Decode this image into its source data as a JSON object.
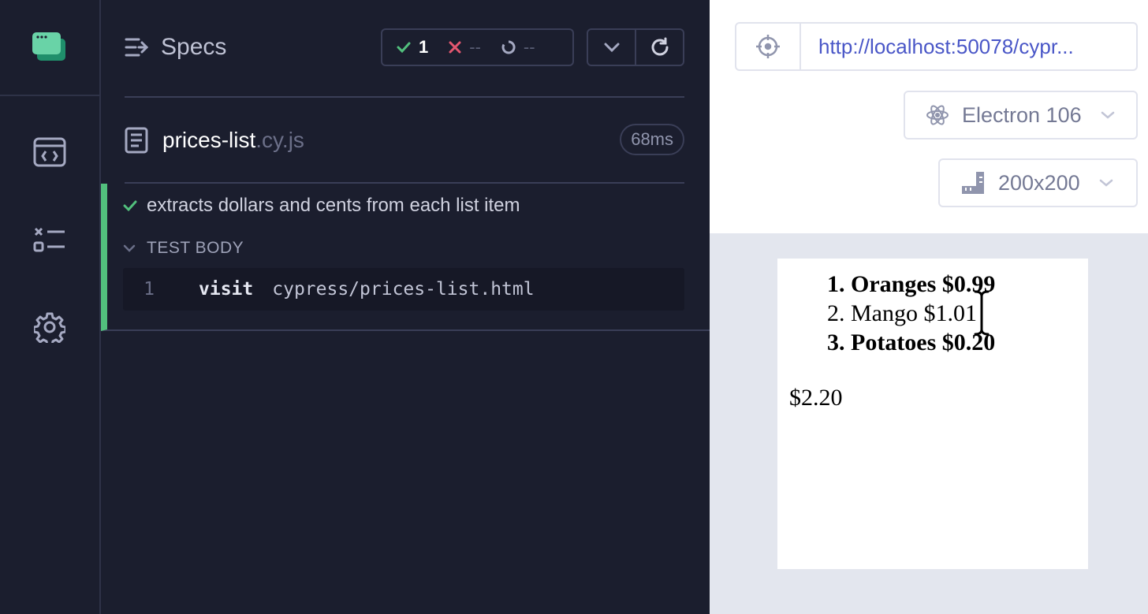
{
  "specs_panel": {
    "title": "Specs",
    "stats": {
      "passed": "1",
      "failed": "--",
      "pending": "--"
    }
  },
  "spec": {
    "name": "prices-list",
    "ext": ".cy.js",
    "duration": "68ms"
  },
  "test": {
    "title": "extracts dollars and cents from each list item",
    "body_label": "TEST BODY",
    "commands": [
      {
        "num": "1",
        "name": "visit",
        "arg": "cypress/prices-list.html"
      }
    ]
  },
  "aut": {
    "url": "http://localhost:50078/cypr...",
    "browser": "Electron 106",
    "viewport": "200x200",
    "list": [
      {
        "label": "1. Oranges $0.99",
        "bold": true
      },
      {
        "label": "2. Mango $1.01",
        "bold": false
      },
      {
        "label": "3. Potatoes $0.20",
        "bold": true
      }
    ],
    "total": "$2.20"
  },
  "colors": {
    "pass": "#52c07d",
    "fail": "#e45770",
    "accent_link": "#4956c7",
    "logo": "#69d3a7"
  }
}
